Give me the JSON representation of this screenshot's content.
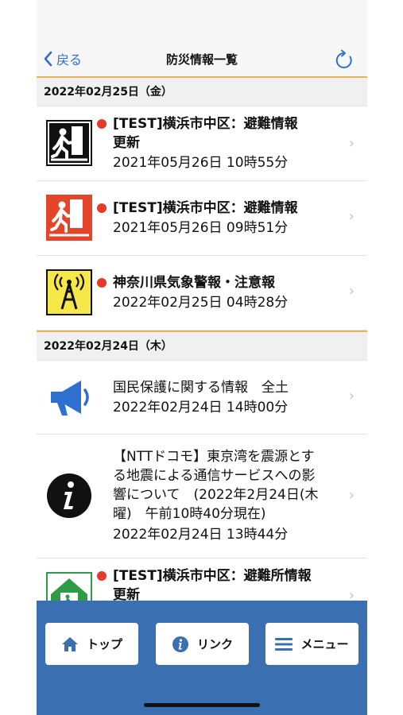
{
  "nav": {
    "back_label": "戻る",
    "title": "防災情報一覧"
  },
  "sections": [
    {
      "date": "2022年02月25日（金）",
      "items": [
        {
          "title_line1": "[TEST]横浜市中区：避難情報",
          "title_line2": "更新",
          "date": "2021年05月26日 10時55分",
          "icon": "evacuation-icon"
        },
        {
          "title_line1": "[TEST]横浜市中区：避難情報",
          "date": "2021年05月26日 09時51分",
          "icon": "evacuation-red-icon"
        },
        {
          "title_line1": "神奈川県気象警報・注意報",
          "date": "2022年02月25日 04時28分",
          "icon": "weather-warning-icon"
        }
      ]
    },
    {
      "date": "2022年02月24日（木）",
      "items": [
        {
          "title_line1": "国民保護に関する情報　全土",
          "date": "2022年02月24日 14時00分",
          "icon": "megaphone-icon"
        },
        {
          "title_lines": [
            "【NTTドコモ】東京湾を震源とす",
            "る地震による通信サービスへの影",
            "響について　(2022年2月24日(木",
            "曜)　午前10時40分現在)"
          ],
          "date": "2022年02月24日 13時44分",
          "icon": "info-icon"
        },
        {
          "title_line1": "[TEST]横浜市中区：避難所情報",
          "title_line2": "更新",
          "icon": "shelter-icon"
        }
      ]
    }
  ],
  "toolbar": {
    "top_label": "トップ",
    "link_label": "リンク",
    "menu_label": "メニュー"
  },
  "colors": {
    "accent": "#2f6fd0",
    "toolbar": "#3a6fb2",
    "unread_dot": "#e53a2a",
    "divider": "#e8b35a"
  }
}
